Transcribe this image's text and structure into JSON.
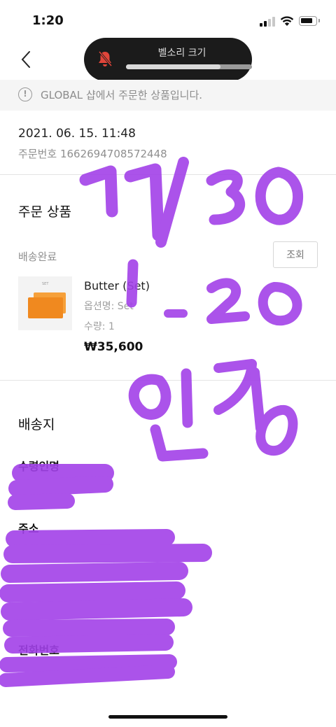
{
  "status_bar": {
    "time": "1:20"
  },
  "volume_hud": {
    "label": "벨소리 크기",
    "level": 0.75
  },
  "notice": {
    "text": "GLOBAL 샵에서 주문한 상품입니다."
  },
  "order": {
    "date": "2021. 06. 15. 11:48",
    "order_number": "주문번호 1662694708572448"
  },
  "order_items": {
    "title": "주문 상품",
    "status": "배송완료",
    "track_button": "조회",
    "item": {
      "thumb_tag": "SET",
      "name": "Butter (Set)",
      "option": "옵션명: Set",
      "quantity": "수량: 1",
      "price": "₩35,600"
    }
  },
  "shipping": {
    "title": "배송지",
    "recipient_label": "수령인명",
    "address_label": "주소",
    "phone_label": "전화번호"
  },
  "colors": {
    "scribble": "#a241e8",
    "hud_bg": "#1b1b1b",
    "notice_bg": "#f5f5f5"
  }
}
